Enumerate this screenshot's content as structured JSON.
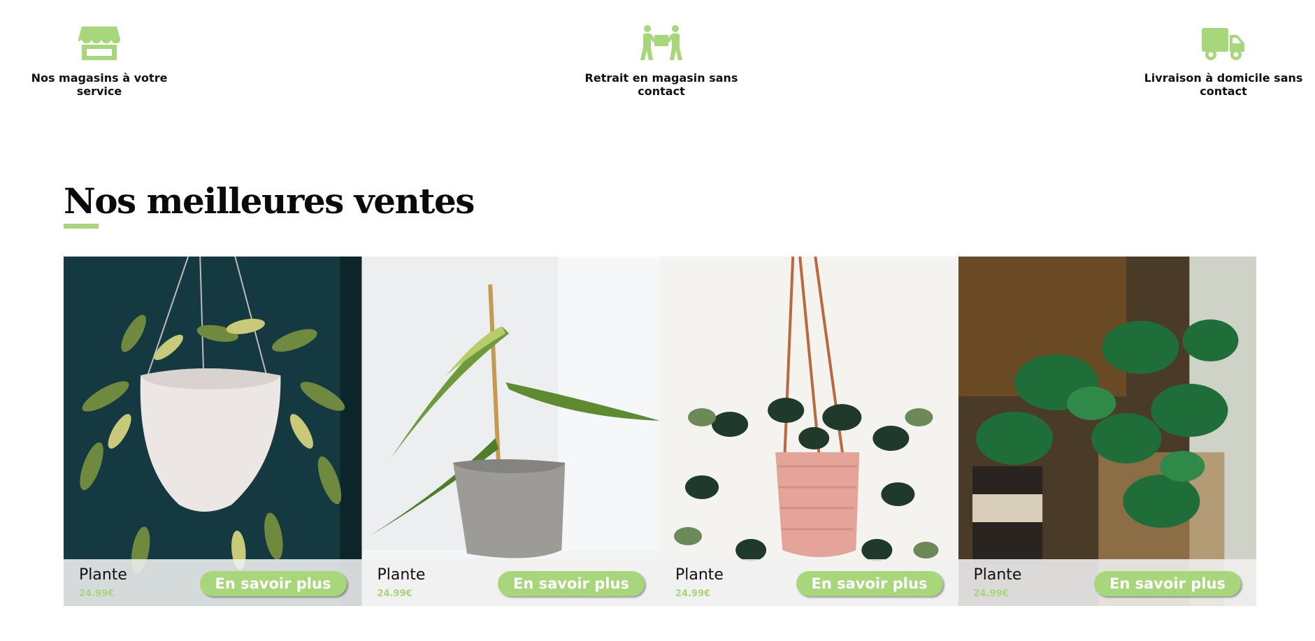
{
  "features": [
    {
      "icon": "storefront-icon",
      "label": "Nos magasins à votre service"
    },
    {
      "icon": "people-carrying-box-icon",
      "label": "Retrait en magasin sans contact"
    },
    {
      "icon": "delivery-truck-icon",
      "label": "Livraison à domicile sans contact"
    }
  ],
  "section": {
    "title": "Nos meilleures ventes"
  },
  "products": [
    {
      "name": "Plante",
      "price": "24.99€",
      "button": "En savoir plus",
      "image": "hanging-hoya-plant-white-pot"
    },
    {
      "name": "Plante",
      "price": "24.99€",
      "button": "En savoir plus",
      "image": "vanilla-orchid-grey-pot"
    },
    {
      "name": "Plante",
      "price": "24.99€",
      "button": "En savoir plus",
      "image": "hanging-scindapsus-pink-pot"
    },
    {
      "name": "Plante",
      "price": "24.99€",
      "button": "En savoir plus",
      "image": "monstera-adansonii-shelf"
    }
  ],
  "colors": {
    "accent": "#a8d67a",
    "text": "#111111",
    "footer_bg": "#f0f0f0"
  }
}
